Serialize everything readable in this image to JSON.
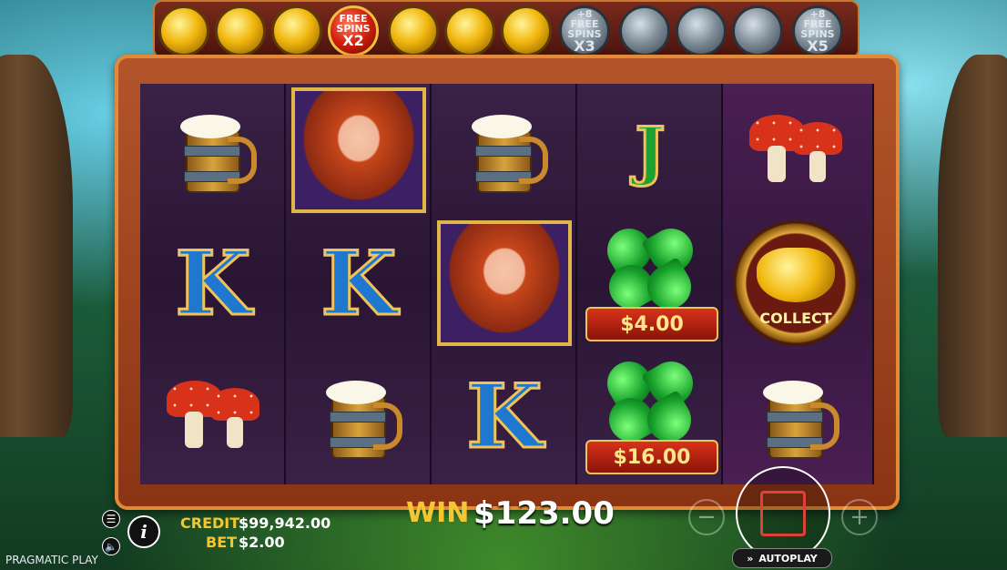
{
  "meter": {
    "coins": [
      {
        "kind": "gold",
        "label": ""
      },
      {
        "kind": "gold",
        "label": ""
      },
      {
        "kind": "gold",
        "label": ""
      },
      {
        "kind": "red",
        "label_top": "FREE SPINS",
        "label_bottom": "X2"
      },
      {
        "kind": "gold",
        "label": ""
      },
      {
        "kind": "gold",
        "label": ""
      },
      {
        "kind": "gold",
        "label": ""
      },
      {
        "kind": "grey",
        "label_top": "+8 FREE SPINS",
        "label_bottom": "X3"
      },
      {
        "kind": "grey",
        "label": ""
      },
      {
        "kind": "grey",
        "label": ""
      },
      {
        "kind": "grey",
        "label": ""
      },
      {
        "kind": "grey",
        "label_top": "+8 FREE SPINS",
        "label_bottom": "X5"
      }
    ]
  },
  "reels": {
    "clover_values": [
      "$4.00",
      "$16.00"
    ],
    "pot_label": "COLLECT",
    "letters": {
      "k": "K",
      "j": "J"
    }
  },
  "hud": {
    "credit_label": "CREDIT",
    "credit_value": "$99,942.00",
    "bet_label": "BET",
    "bet_value": "$2.00",
    "win_label": "WIN",
    "win_value": "$123.00",
    "brand": "PRAGMATIC PLAY",
    "autoplay": "AUTOPLAY",
    "minus": "−",
    "plus": "+",
    "info": "i",
    "menu_glyph": "☰",
    "sound_glyph": "🔈"
  }
}
